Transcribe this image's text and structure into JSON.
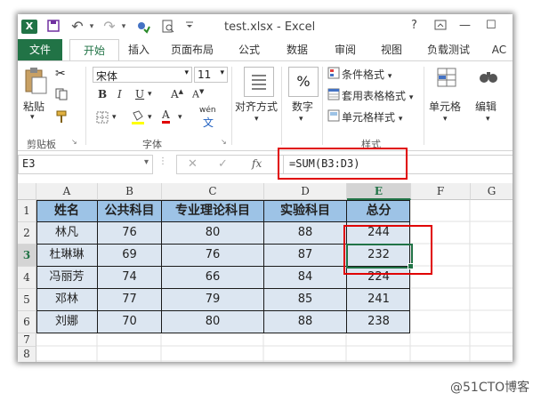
{
  "window": {
    "title": "test.xlsx - Excel",
    "help": "?",
    "minimize": "—",
    "maximize": "☐"
  },
  "qat": {
    "save": "💾",
    "undo": "↶",
    "redo": "↷"
  },
  "tabs": [
    "文件",
    "开始",
    "插入",
    "页面布局",
    "公式",
    "数据",
    "审阅",
    "视图",
    "负载测试",
    "AC"
  ],
  "ribbon": {
    "clipboard": {
      "paste": "粘贴",
      "group": "剪贴板"
    },
    "font": {
      "name": "宋体",
      "size": "11",
      "bold": "B",
      "italic": "I",
      "underline": "U",
      "grow": "A",
      "shrink": "A",
      "color": "A",
      "wen": "wén",
      "group": "字体"
    },
    "alignment": {
      "label": "对齐方式"
    },
    "number": {
      "label": "数字",
      "symbol": "%"
    },
    "styles": {
      "conditional": "条件格式",
      "table": "套用表格格式",
      "cell": "单元格样式",
      "group": "样式"
    },
    "cells": {
      "label": "单元格"
    },
    "editing": {
      "label": "编辑"
    }
  },
  "formula_bar": {
    "name_box": "E3",
    "cancel": "✕",
    "enter": "✓",
    "fx": "fx",
    "formula": "=SUM(B3:D3)"
  },
  "sheet": {
    "columns": [
      "A",
      "B",
      "C",
      "D",
      "E",
      "F",
      "G"
    ],
    "rows": [
      "1",
      "2",
      "3",
      "4",
      "5",
      "6",
      "7",
      "8"
    ],
    "headers": [
      "姓名",
      "公共科目",
      "专业理论科目",
      "实验科目",
      "总分"
    ],
    "data": [
      [
        "林凡",
        "76",
        "80",
        "88",
        "244"
      ],
      [
        "杜琳琳",
        "69",
        "76",
        "87",
        "232"
      ],
      [
        "冯丽芳",
        "74",
        "66",
        "84",
        "224"
      ],
      [
        "邓林",
        "77",
        "79",
        "85",
        "241"
      ],
      [
        "刘娜",
        "70",
        "80",
        "88",
        "238"
      ]
    ],
    "header_fill": "#9dc3e6",
    "data_fill": "#dce6f1",
    "selected_cell": "E3"
  },
  "watermark": "@51CTO博客"
}
